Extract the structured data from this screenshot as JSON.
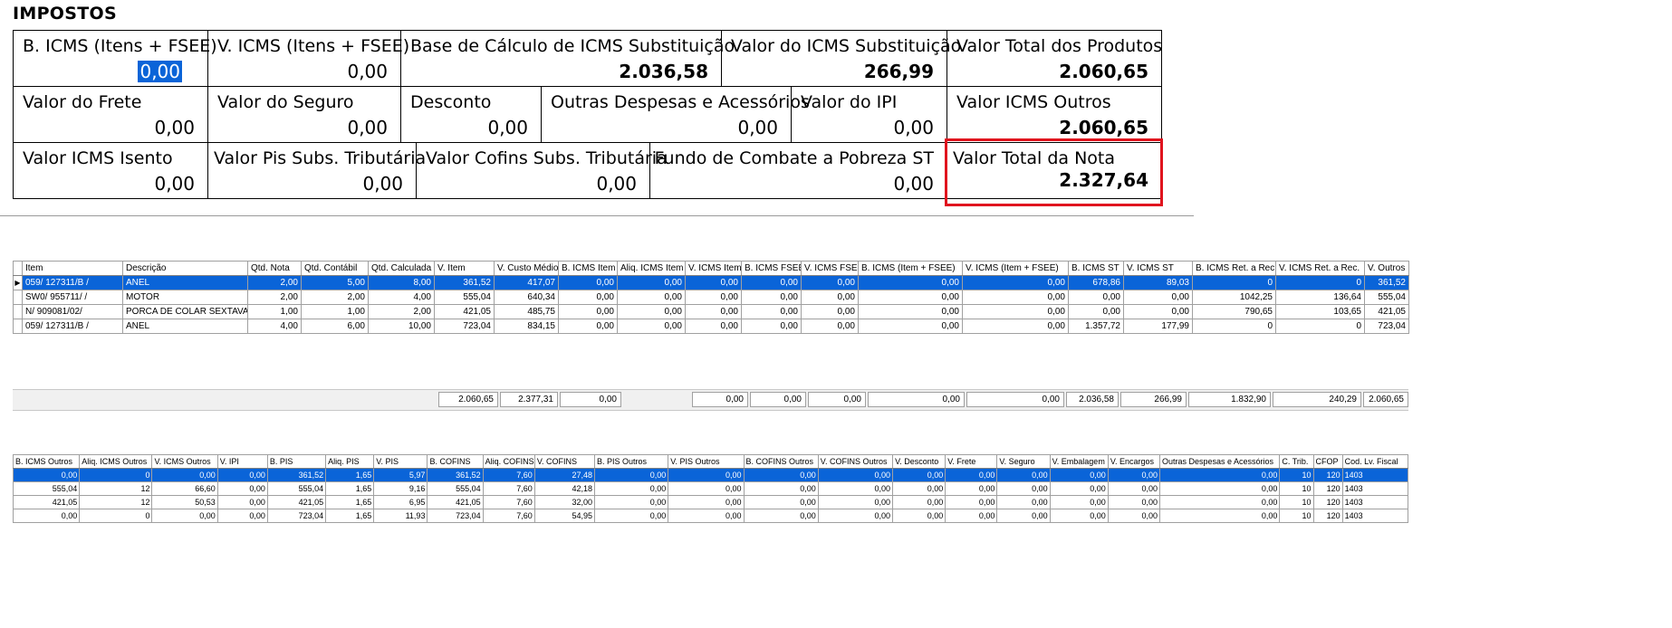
{
  "section_title": "IMPOSTOS",
  "fields": [
    {
      "label": "B. ICMS (Itens + FSEE)",
      "value": "0,00"
    },
    {
      "label": "V. ICMS (Itens + FSEE)",
      "value": "0,00"
    },
    {
      "label": "Base de Cálculo de ICMS Substituição",
      "value": "2.036,58"
    },
    {
      "label": "Valor do ICMS Substituição",
      "value": "266,99"
    },
    {
      "label": "Valor Total dos Produtos",
      "value": "2.060,65"
    },
    {
      "label": "Valor do Frete",
      "value": "0,00"
    },
    {
      "label": "Valor do Seguro",
      "value": "0,00"
    },
    {
      "label": "Desconto",
      "value": "0,00"
    },
    {
      "label": "Outras Despesas e Acessórios",
      "value": "0,00"
    },
    {
      "label": "Valor do IPI",
      "value": "0,00"
    },
    {
      "label": "Valor ICMS Outros",
      "value": "2.060,65"
    },
    {
      "label": "Valor ICMS Isento",
      "value": "0,00"
    },
    {
      "label": "Valor Pis Subs. Tributária",
      "value": "0,00"
    },
    {
      "label": "Valor Cofins Subs. Tributária",
      "value": "0,00"
    },
    {
      "label": "Fundo de Combate a Pobreza ST",
      "value": "0,00"
    },
    {
      "label": "Valor Total da Nota",
      "value": "2.327,64"
    }
  ],
  "items_grid": {
    "columns": [
      "Item",
      "Descrição",
      "Qtd. Nota",
      "Qtd. Contábil",
      "Qtd. Calculada",
      "V. Item",
      "V. Custo Médio",
      "B. ICMS Item",
      "Aliq. ICMS Item",
      "V. ICMS Item",
      "B. ICMS FSEE",
      "V. ICMS FSEE",
      "B. ICMS (Item + FSEE)",
      "V. ICMS (Item + FSEE)",
      "B. ICMS ST",
      "V. ICMS ST",
      "B. ICMS Ret. a Rec.",
      "V. ICMS Ret. a Rec.",
      "V. Outros"
    ],
    "rows": [
      [
        "059/ 127311/B /",
        "ANEL",
        "2,00",
        "5,00",
        "8,00",
        "361,52",
        "417,07",
        "0,00",
        "0,00",
        "0,00",
        "0,00",
        "0,00",
        "0,00",
        "0,00",
        "678,86",
        "89,03",
        "0",
        "0",
        "361,52"
      ],
      [
        "SW0/ 955711/ /",
        "MOTOR",
        "2,00",
        "2,00",
        "4,00",
        "555,04",
        "640,34",
        "0,00",
        "0,00",
        "0,00",
        "0,00",
        "0,00",
        "0,00",
        "0,00",
        "0,00",
        "0,00",
        "1042,25",
        "136,64",
        "555,04"
      ],
      [
        "N/ 909081/02/",
        "PORCA DE COLAR SEXTAVAD",
        "1,00",
        "1,00",
        "2,00",
        "421,05",
        "485,75",
        "0,00",
        "0,00",
        "0,00",
        "0,00",
        "0,00",
        "0,00",
        "0,00",
        "0,00",
        "0,00",
        "790,65",
        "103,65",
        "421,05"
      ],
      [
        "059/ 127311/B /",
        "ANEL",
        "4,00",
        "6,00",
        "10,00",
        "723,04",
        "834,15",
        "0,00",
        "0,00",
        "0,00",
        "0,00",
        "0,00",
        "0,00",
        "0,00",
        "1.357,72",
        "177,99",
        "0",
        "0",
        "723,04"
      ]
    ],
    "totals": [
      "2.060,65",
      "2.377,31",
      "0,00",
      "0,00",
      "0,00",
      "0,00",
      "0,00",
      "0,00",
      "2.036,58",
      "266,99",
      "1.832,90",
      "240,29",
      "2.060,65"
    ]
  },
  "taxes_grid": {
    "columns": [
      "B. ICMS Outros",
      "Aliq. ICMS Outros",
      "V. ICMS Outros",
      "V. IPI",
      "B. PIS",
      "Aliq. PIS",
      "V. PIS",
      "B. COFINS",
      "Aliq. COFINS",
      "V. COFINS",
      "B. PIS Outros",
      "V. PIS Outros",
      "B. COFINS Outros",
      "V. COFINS Outros",
      "V. Desconto",
      "V. Frete",
      "V. Seguro",
      "V. Embalagem",
      "V. Encargos",
      "Outras Despesas e Acessórios",
      "C. Trib.",
      "CFOP",
      "Cod. Lv. Fiscal"
    ],
    "rows": [
      [
        "0,00",
        "0",
        "0,00",
        "0,00",
        "361,52",
        "1,65",
        "5,97",
        "361,52",
        "7,60",
        "27,48",
        "0,00",
        "0,00",
        "0,00",
        "0,00",
        "0,00",
        "0,00",
        "0,00",
        "0,00",
        "0,00",
        "0,00",
        "10",
        "120",
        "1403"
      ],
      [
        "555,04",
        "12",
        "66,60",
        "0,00",
        "555,04",
        "1,65",
        "9,16",
        "555,04",
        "7,60",
        "42,18",
        "0,00",
        "0,00",
        "0,00",
        "0,00",
        "0,00",
        "0,00",
        "0,00",
        "0,00",
        "0,00",
        "0,00",
        "10",
        "120",
        "1403"
      ],
      [
        "421,05",
        "12",
        "50,53",
        "0,00",
        "421,05",
        "1,65",
        "6,95",
        "421,05",
        "7,60",
        "32,00",
        "0,00",
        "0,00",
        "0,00",
        "0,00",
        "0,00",
        "0,00",
        "0,00",
        "0,00",
        "0,00",
        "0,00",
        "10",
        "120",
        "1403"
      ],
      [
        "0,00",
        "0",
        "0,00",
        "0,00",
        "723,04",
        "1,65",
        "11,93",
        "723,04",
        "7,60",
        "54,95",
        "0,00",
        "0,00",
        "0,00",
        "0,00",
        "0,00",
        "0,00",
        "0,00",
        "0,00",
        "0,00",
        "0,00",
        "10",
        "120",
        "1403"
      ]
    ]
  },
  "colors": {
    "selection": "#0a64d8",
    "highlight_border": "#e0141e"
  }
}
